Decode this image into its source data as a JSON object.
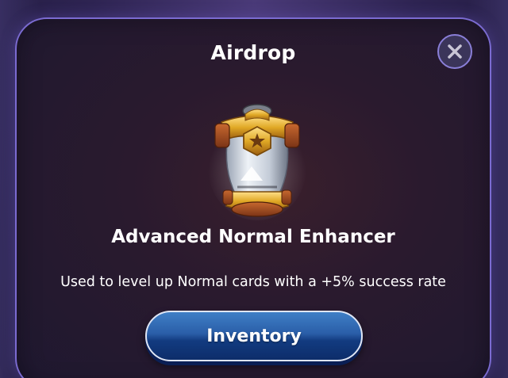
{
  "modal": {
    "title": "Airdrop",
    "close_icon": "close-icon",
    "item": {
      "icon": "enhancer-capsule-icon",
      "name": "Advanced Normal Enhancer",
      "description": "Used to level up Normal cards with a +5% success rate"
    },
    "inventory_button_label": "Inventory"
  },
  "colors": {
    "modal_border": "#7b6bd1",
    "button_top": "#3f7fc6",
    "button_bottom": "#0d2d6a",
    "gold": "#e0a825"
  }
}
